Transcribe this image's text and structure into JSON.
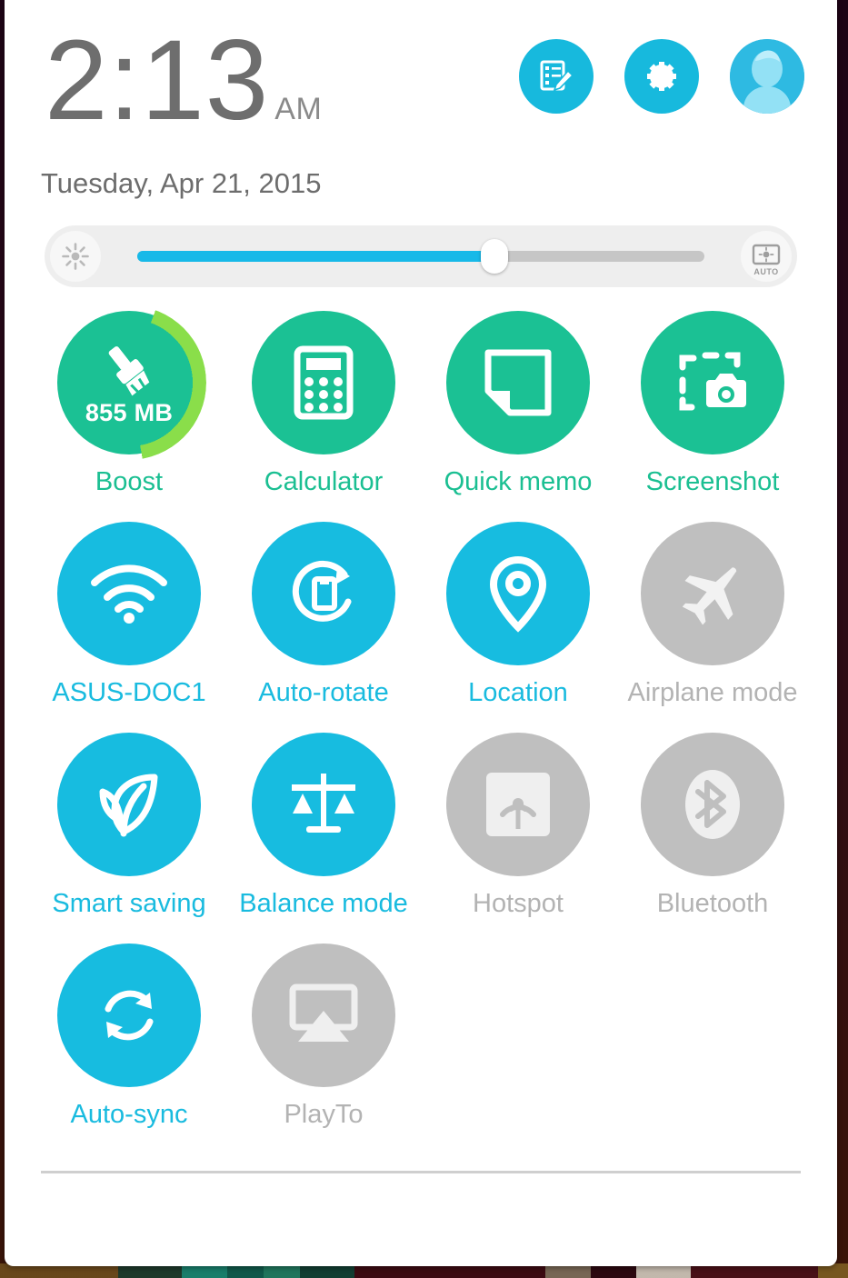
{
  "statusbar": {
    "clock_time": "2:13",
    "clock_ampm": "AM",
    "date": "Tuesday, Apr 21, 2015"
  },
  "header_actions": [
    {
      "name": "edit-quick-settings",
      "icon": "note-edit-icon",
      "label": "Edit quick settings"
    },
    {
      "name": "settings",
      "icon": "gear-icon",
      "label": "Settings"
    },
    {
      "name": "user-profile",
      "icon": "avatar-icon",
      "label": "User profile"
    }
  ],
  "brightness": {
    "left_icon": "brightness-sun-icon",
    "right_icon": "auto-brightness-icon",
    "auto_label": "AUTO",
    "value_percent": 63
  },
  "colors": {
    "green": "#1bc194",
    "green_text": "#1bbf92",
    "cyan": "#17bce0",
    "cyan_text": "#19bbdf",
    "gray": "#bfbfbf",
    "gray_text": "#b3b3b3",
    "boost_ring": "#8ade4a",
    "slider_fill": "#17b9e8",
    "clock_text": "#6e6e6e"
  },
  "tiles": [
    {
      "label": "Boost",
      "icon": "broom-icon",
      "state": "green",
      "badge": "855 MB",
      "ring": true
    },
    {
      "label": "Calculator",
      "icon": "calculator-icon",
      "state": "green"
    },
    {
      "label": "Quick memo",
      "icon": "note-icon",
      "state": "green"
    },
    {
      "label": "Screenshot",
      "icon": "screenshot-icon",
      "state": "green"
    },
    {
      "label": "ASUS-DOC1",
      "icon": "wifi-icon",
      "state": "cyan"
    },
    {
      "label": "Auto-rotate",
      "icon": "auto-rotate-icon",
      "state": "cyan"
    },
    {
      "label": "Location",
      "icon": "location-pin-icon",
      "state": "cyan"
    },
    {
      "label": "Airplane mode",
      "icon": "airplane-icon",
      "state": "gray"
    },
    {
      "label": "Smart saving",
      "icon": "leaf-icon",
      "state": "cyan"
    },
    {
      "label": "Balance mode",
      "icon": "scales-icon",
      "state": "cyan"
    },
    {
      "label": "Hotspot",
      "icon": "hotspot-icon",
      "state": "gray"
    },
    {
      "label": "Bluetooth",
      "icon": "bluetooth-icon",
      "state": "gray"
    },
    {
      "label": "Auto-sync",
      "icon": "sync-icon",
      "state": "cyan"
    },
    {
      "label": "PlayTo",
      "icon": "cast-icon",
      "state": "gray"
    }
  ]
}
